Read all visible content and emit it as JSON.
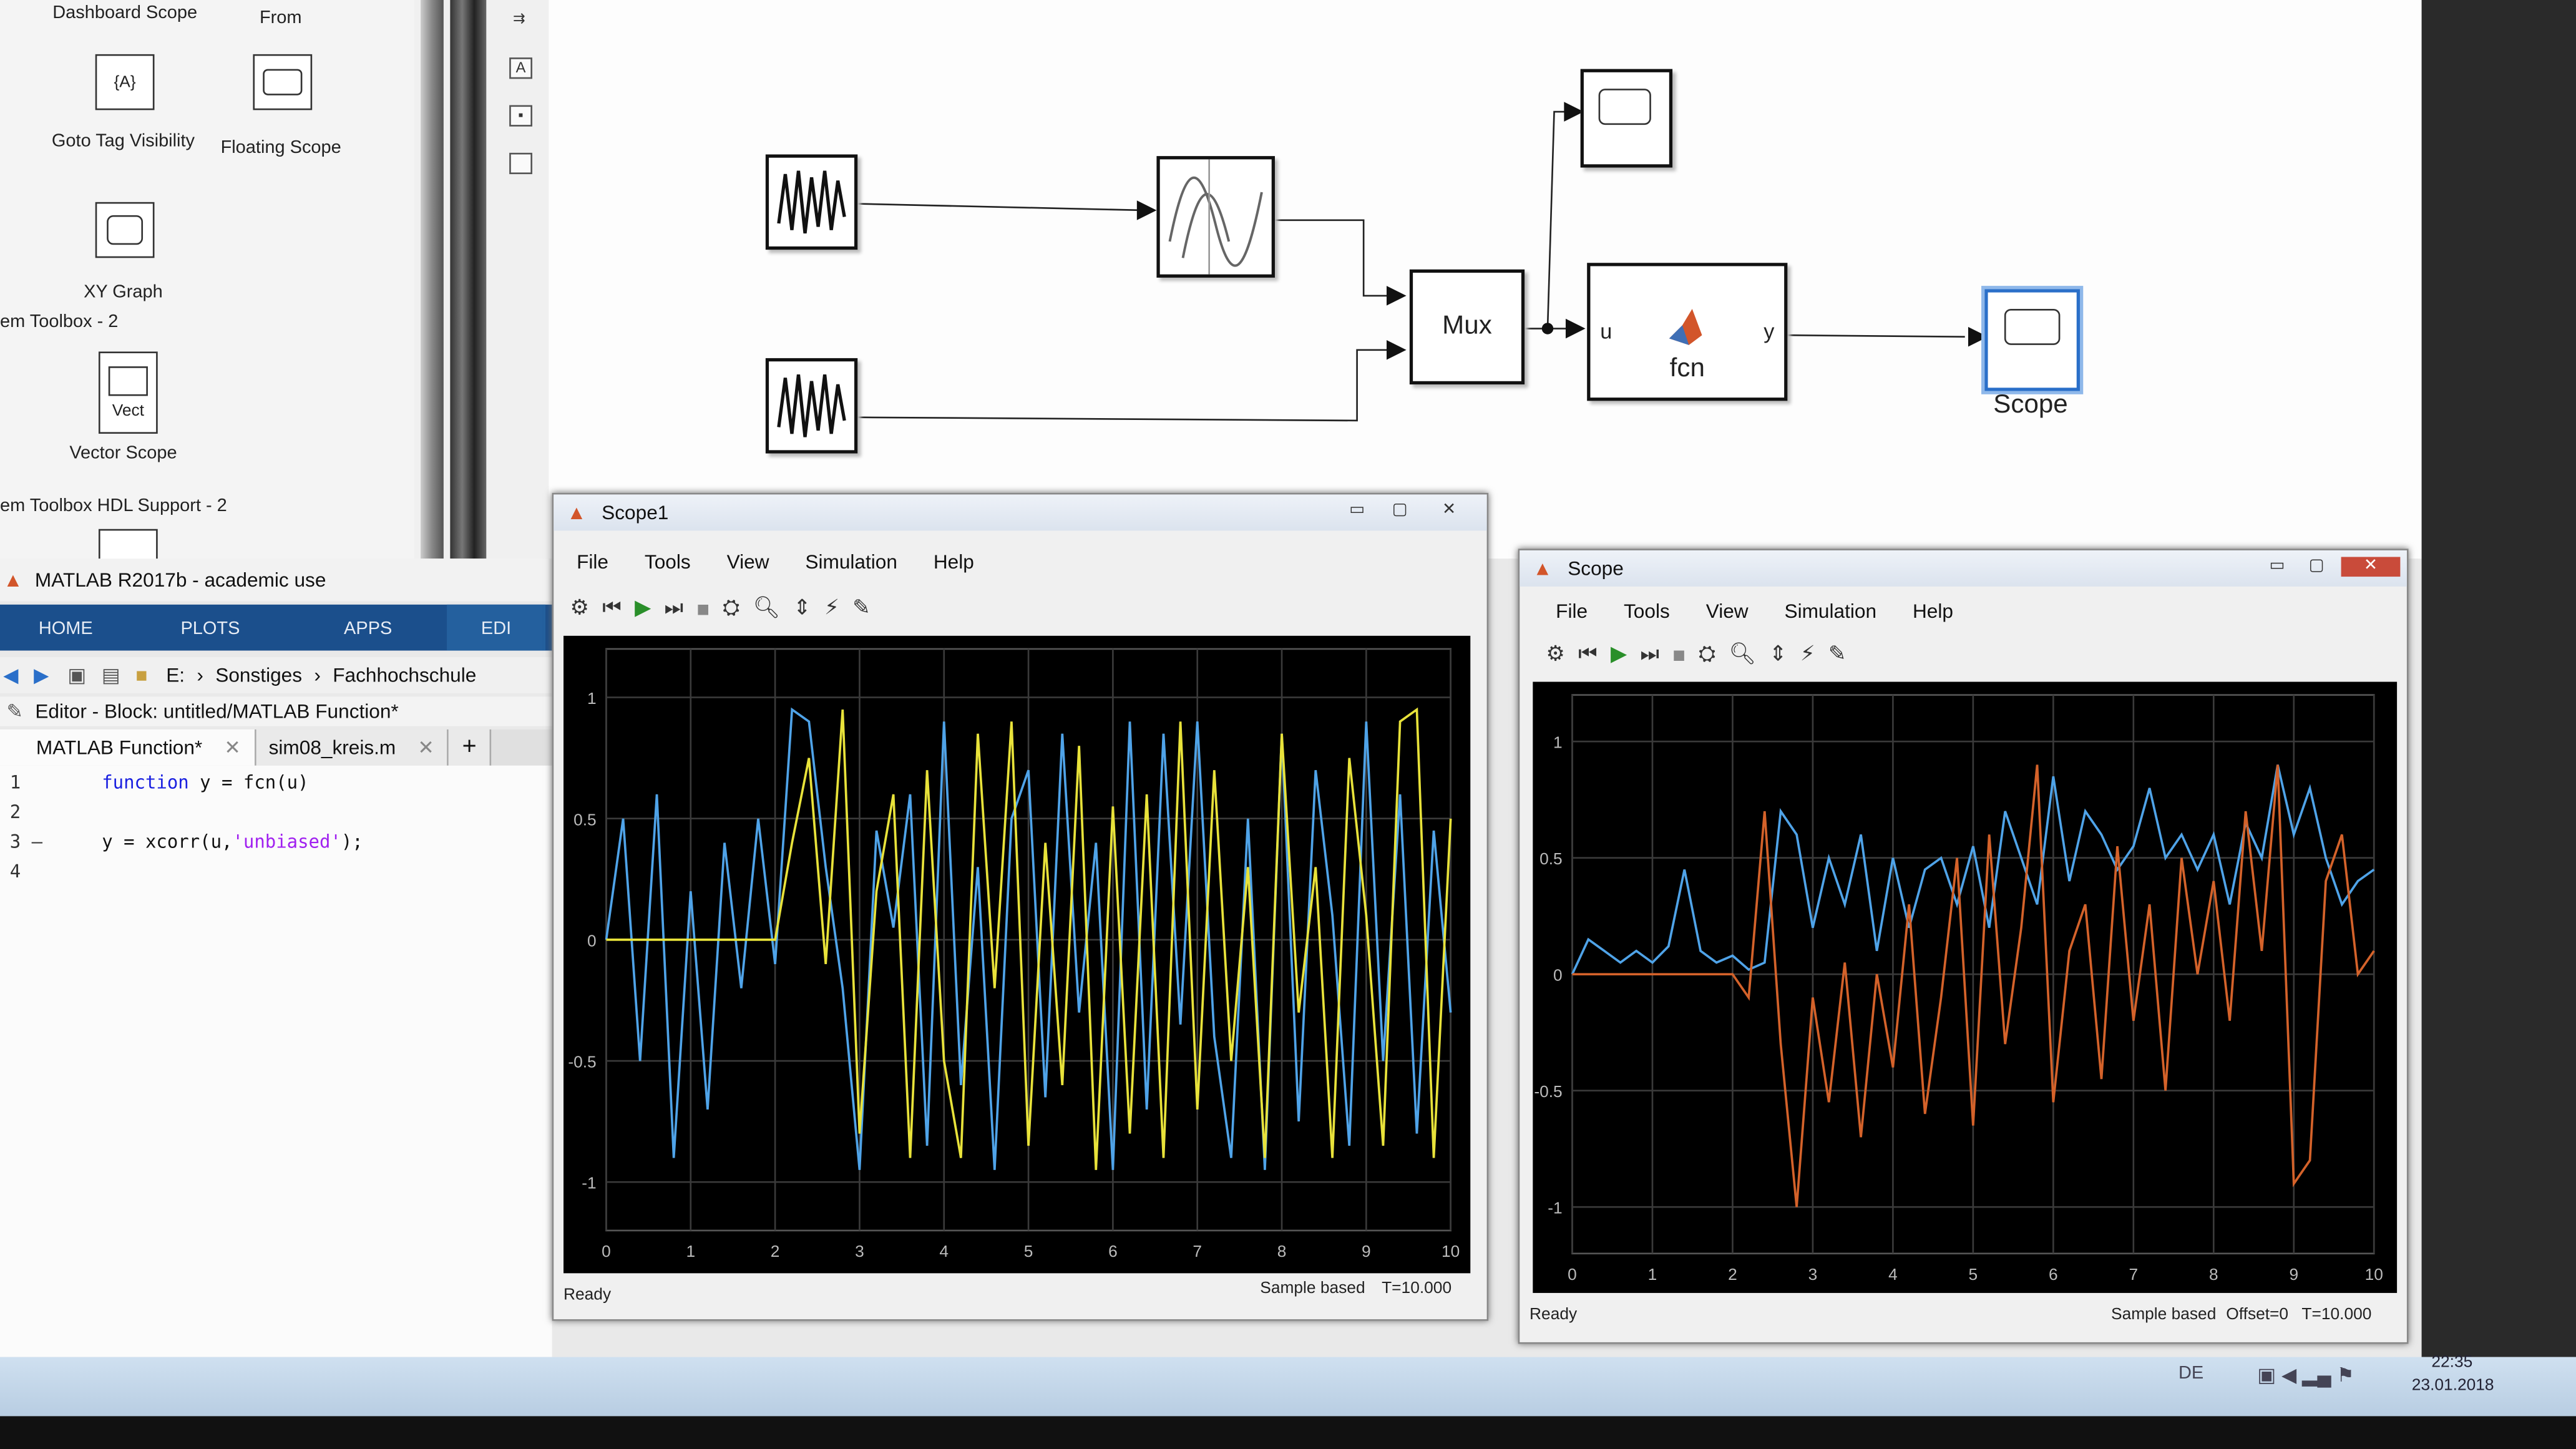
{
  "library": {
    "top_labels": [
      "Dashboard Scope",
      "From"
    ],
    "blocks": [
      {
        "icon": "{A}",
        "label": "Goto Tag Visibility"
      },
      {
        "icon": "",
        "label": "Floating Scope"
      },
      {
        "icon": "",
        "label": "XY Graph"
      },
      {
        "icon": "Vect",
        "label": "Vector Scope"
      }
    ],
    "sections": [
      "em Toolbox - 2",
      "em Toolbox HDL Support - 2"
    ]
  },
  "model": {
    "blocks": {
      "mux": "Mux",
      "fcn": "fcn",
      "fcn_in": "u",
      "fcn_out": "y",
      "scope": "Scope"
    }
  },
  "matlab": {
    "title": "MATLAB R2017b - academic use",
    "ribbon_tabs": [
      "HOME",
      "PLOTS",
      "APPS",
      "EDI"
    ],
    "path": [
      "E:",
      "Sonstiges",
      "Fachhochschule"
    ],
    "editor_title": "Editor - Block: untitled/MATLAB Function*",
    "tabs": [
      "MATLAB Function*",
      "sim08_kreis.m"
    ],
    "code_lines": [
      {
        "n": "1",
        "parts": [
          {
            "t": "function",
            "c": "kw"
          },
          {
            "t": " y = fcn(u)",
            "c": ""
          }
        ]
      },
      {
        "n": "2",
        "parts": []
      },
      {
        "n": "3 –",
        "parts": [
          {
            "t": "y = xcorr(u,",
            "c": ""
          },
          {
            "t": "'unbiased'",
            "c": "str"
          },
          {
            "t": ");",
            "c": ""
          }
        ]
      },
      {
        "n": "4",
        "parts": []
      }
    ]
  },
  "scope1": {
    "title": "Scope1",
    "menu": [
      "File",
      "Tools",
      "View",
      "Simulation",
      "Help"
    ],
    "status_left": "Ready",
    "status_right": [
      "Sample based",
      "T=10.000"
    ]
  },
  "scope2": {
    "title": "Scope",
    "menu": [
      "File",
      "Tools",
      "View",
      "Simulation",
      "Help"
    ],
    "status_left": "Ready",
    "status_right": [
      "Sample based",
      "Offset=0",
      "T=10.000"
    ]
  },
  "taskbar": {
    "lang": "DE",
    "time": "22:35",
    "date": "23.01.2018"
  },
  "chart_data": [
    {
      "type": "line",
      "title": "Scope1",
      "xlim": [
        0,
        10
      ],
      "ylim": [
        -1.2,
        1.2
      ],
      "xticks": [
        "0",
        "1",
        "2",
        "3",
        "4",
        "5",
        "6",
        "7",
        "8",
        "9",
        "10"
      ],
      "yticks": [
        "1",
        "0.5",
        "0",
        "-0.5",
        "-1"
      ],
      "grid": true,
      "colors": [
        "#4fa3e8",
        "#e8e23a"
      ],
      "series": [
        {
          "x": [
            0,
            0.2,
            0.4,
            0.6,
            0.8,
            1,
            1.2,
            1.4,
            1.6,
            1.8,
            2,
            2.2,
            2.4,
            2.6,
            2.8,
            3,
            3.2,
            3.4,
            3.6,
            3.8,
            4,
            4.2,
            4.4,
            4.6,
            4.8,
            5,
            5.2,
            5.4,
            5.6,
            5.8,
            6,
            6.2,
            6.4,
            6.6,
            6.8,
            7,
            7.2,
            7.4,
            7.6,
            7.8,
            8,
            8.2,
            8.4,
            8.6,
            8.8,
            9,
            9.2,
            9.4,
            9.6,
            9.8,
            10
          ],
          "values": [
            0,
            0.5,
            -0.5,
            0.6,
            -0.9,
            0.2,
            -0.7,
            0.4,
            -0.2,
            0.5,
            -0.1,
            0.95,
            0.9,
            0.3,
            -0.2,
            -0.95,
            0.45,
            0.05,
            0.6,
            -0.85,
            0.9,
            -0.6,
            0.3,
            -0.95,
            0.5,
            0.7,
            -0.65,
            0.85,
            -0.3,
            0.4,
            -0.95,
            0.9,
            -0.7,
            0.85,
            -0.35,
            0.9,
            -0.4,
            -0.9,
            0.5,
            -0.95,
            0.85,
            -0.75,
            0.7,
            0.1,
            -0.85,
            0.9,
            -0.5,
            0.6,
            -0.8,
            0.45,
            -0.3
          ]
        },
        {
          "x": [
            0,
            0.5,
            1,
            1.5,
            2,
            2.2,
            2.4,
            2.6,
            2.8,
            3,
            3.2,
            3.4,
            3.6,
            3.8,
            4,
            4.2,
            4.4,
            4.6,
            4.8,
            5,
            5.2,
            5.4,
            5.6,
            5.8,
            6,
            6.2,
            6.4,
            6.6,
            6.8,
            7,
            7.2,
            7.4,
            7.6,
            7.8,
            8,
            8.2,
            8.4,
            8.6,
            8.8,
            9,
            9.2,
            9.4,
            9.6,
            9.8,
            10
          ],
          "values": [
            0,
            0,
            0,
            0,
            0,
            0.4,
            0.75,
            -0.1,
            0.95,
            -0.8,
            0.2,
            0.6,
            -0.9,
            0.7,
            -0.5,
            -0.9,
            0.85,
            -0.2,
            0.9,
            -0.85,
            0.4,
            -0.6,
            0.8,
            -0.95,
            0.55,
            -0.8,
            0.6,
            -0.9,
            0.9,
            -0.7,
            0.7,
            -0.5,
            0.3,
            -0.9,
            0.85,
            -0.3,
            0.3,
            -0.9,
            0.75,
            0.1,
            -0.85,
            0.9,
            0.95,
            -0.9,
            0.5
          ]
        }
      ]
    },
    {
      "type": "line",
      "title": "Scope",
      "xlim": [
        0,
        10
      ],
      "ylim": [
        -1.2,
        1.2
      ],
      "xticks": [
        "0",
        "1",
        "2",
        "3",
        "4",
        "5",
        "6",
        "7",
        "8",
        "9",
        "10"
      ],
      "yticks": [
        "1",
        "0.5",
        "0",
        "-0.5",
        "-1"
      ],
      "grid": true,
      "colors": [
        "#4fa3e8",
        "#d4622a"
      ],
      "series": [
        {
          "x": [
            0,
            0.2,
            0.4,
            0.6,
            0.8,
            1,
            1.2,
            1.4,
            1.6,
            1.8,
            2,
            2.2,
            2.4,
            2.6,
            2.8,
            3,
            3.2,
            3.4,
            3.6,
            3.8,
            4,
            4.2,
            4.4,
            4.6,
            4.8,
            5,
            5.2,
            5.4,
            5.6,
            5.8,
            6,
            6.2,
            6.4,
            6.6,
            6.8,
            7,
            7.2,
            7.4,
            7.6,
            7.8,
            8,
            8.2,
            8.4,
            8.6,
            8.8,
            9,
            9.2,
            9.4,
            9.6,
            9.8,
            10
          ],
          "values": [
            0,
            0.15,
            0.1,
            0.05,
            0.1,
            0.05,
            0.12,
            0.45,
            0.1,
            0.05,
            0.08,
            0.02,
            0.05,
            0.7,
            0.6,
            0.2,
            0.5,
            0.3,
            0.6,
            0.1,
            0.5,
            0.2,
            0.45,
            0.5,
            0.3,
            0.55,
            0.2,
            0.7,
            0.5,
            0.3,
            0.85,
            0.4,
            0.7,
            0.6,
            0.45,
            0.55,
            0.8,
            0.5,
            0.6,
            0.45,
            0.6,
            0.3,
            0.65,
            0.5,
            0.9,
            0.6,
            0.8,
            0.5,
            0.3,
            0.4,
            0.45
          ]
        },
        {
          "x": [
            0,
            0.5,
            1,
            1.5,
            2,
            2.2,
            2.4,
            2.6,
            2.8,
            3,
            3.2,
            3.4,
            3.6,
            3.8,
            4,
            4.2,
            4.4,
            4.6,
            4.8,
            5,
            5.2,
            5.4,
            5.6,
            5.8,
            6,
            6.2,
            6.4,
            6.6,
            6.8,
            7,
            7.2,
            7.4,
            7.6,
            7.8,
            8,
            8.2,
            8.4,
            8.6,
            8.8,
            9,
            9.2,
            9.4,
            9.6,
            9.8,
            10
          ],
          "values": [
            0,
            0,
            0,
            0,
            0,
            -0.1,
            0.7,
            -0.3,
            -1.0,
            -0.1,
            -0.55,
            0.05,
            -0.7,
            0.0,
            -0.4,
            0.3,
            -0.6,
            -0.1,
            0.5,
            -0.65,
            0.6,
            -0.3,
            0.2,
            0.9,
            -0.55,
            0.1,
            0.3,
            -0.45,
            0.55,
            -0.2,
            0.3,
            -0.5,
            0.5,
            0.0,
            0.4,
            -0.2,
            0.7,
            0.1,
            0.9,
            -0.9,
            -0.8,
            0.4,
            0.6,
            0.0,
            0.1
          ]
        }
      ]
    }
  ]
}
